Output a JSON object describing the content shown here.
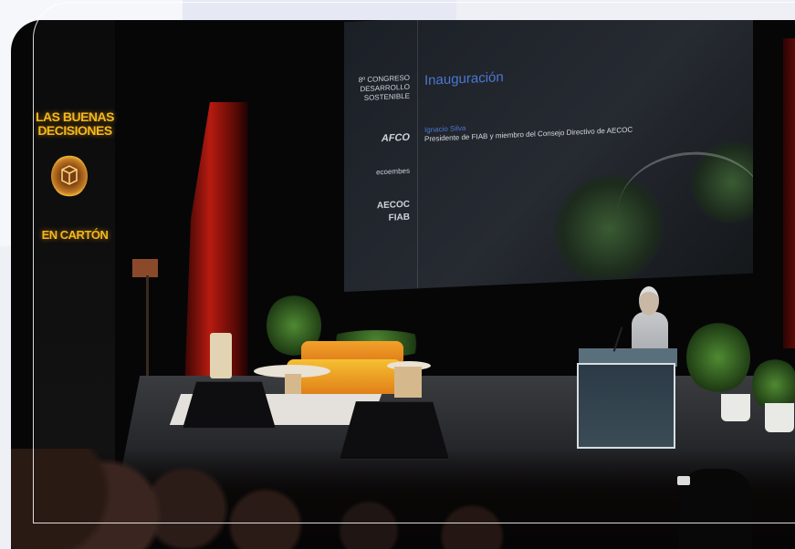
{
  "banner": {
    "line1": "LAS BUENAS",
    "line2": "DECISIONES",
    "line3": "EN CARTÓN",
    "logo_icon": "cardboard-box-icon"
  },
  "slide": {
    "event_line1": "8º CONGRESO",
    "event_line2": "DESARROLLO",
    "event_line3": "SOSTENIBLE",
    "title": "Inauguración",
    "speaker_name": "Ignacio Silva",
    "speaker_role": "Presidente de FIAB y miembro del Consejo Directivo de AECOC",
    "sponsor_1": "AFCO",
    "sponsor_2": "ecoembes",
    "organizer_1": "AECOC",
    "organizer_2": "FIAB"
  },
  "colors": {
    "banner_text": "#f4b81c",
    "slide_title": "#4a78d0",
    "curtain": "#b71b10",
    "sofa": "#f4a12a"
  }
}
